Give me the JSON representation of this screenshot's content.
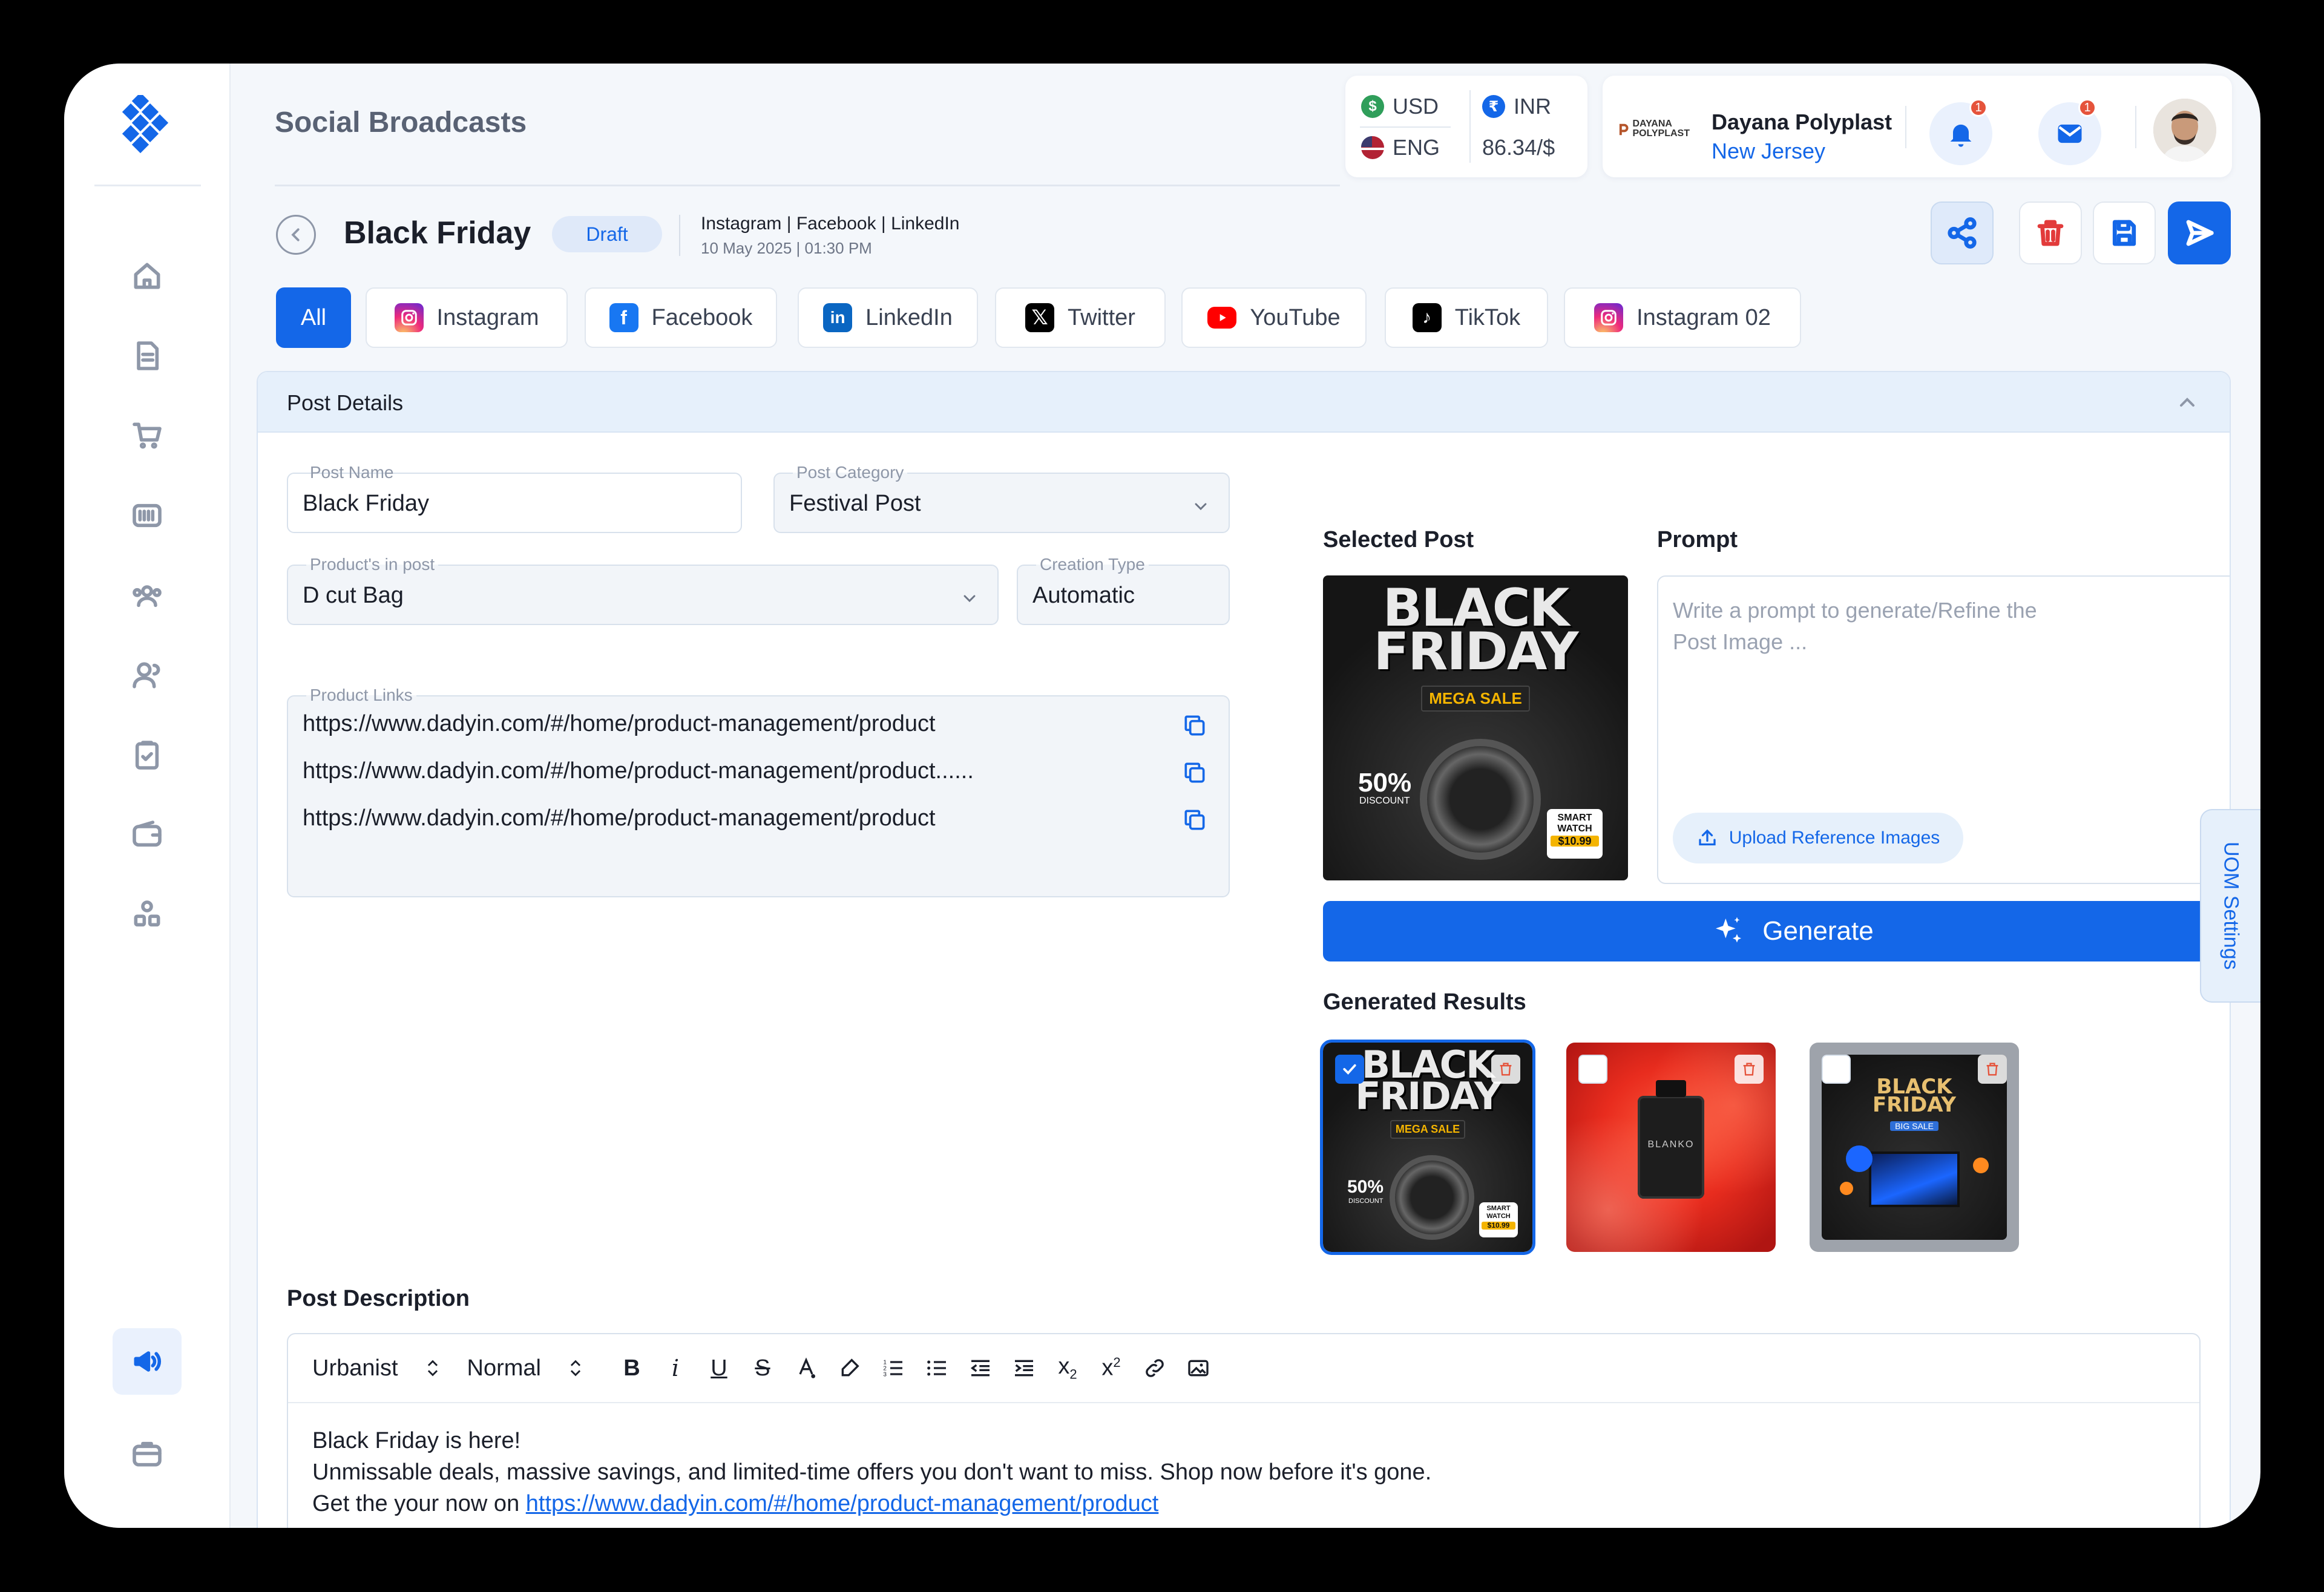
{
  "app": {
    "page_title": "Social Broadcasts"
  },
  "currency": {
    "base": {
      "code": "USD",
      "icon": "dollar-icon"
    },
    "language": {
      "code": "ENG",
      "icon": "us-flag-icon"
    },
    "target": {
      "code": "INR",
      "icon": "rupee-icon"
    },
    "rate": "86.34/$"
  },
  "company": {
    "name": "Dayana Polyplast",
    "location": "New Jersey",
    "logo_text": "DAYANA POLYPLAST"
  },
  "notifications": {
    "bell_count": "1",
    "mail_count": "1"
  },
  "post": {
    "title": "Black Friday",
    "status": "Draft",
    "platforms": "Instagram | Facebook | LinkedIn",
    "datetime": "10 May 2025 | 01:30 PM"
  },
  "tabs": [
    {
      "label": "All",
      "icon": ""
    },
    {
      "label": "Instagram",
      "icon": "instagram-icon"
    },
    {
      "label": "Facebook",
      "icon": "facebook-icon"
    },
    {
      "label": "LinkedIn",
      "icon": "linkedin-icon"
    },
    {
      "label": "Twitter",
      "icon": "x-icon"
    },
    {
      "label": "YouTube",
      "icon": "youtube-icon"
    },
    {
      "label": "TikTok",
      "icon": "tiktok-icon"
    },
    {
      "label": "Instagram 02",
      "icon": "instagram-icon"
    }
  ],
  "details": {
    "section_title": "Post Details",
    "post_name": {
      "label": "Post Name",
      "value": "Black Friday"
    },
    "post_category": {
      "label": "Post Category",
      "value": "Festival Post"
    },
    "products": {
      "label": "Product's in post",
      "value": "D cut Bag"
    },
    "creation_type": {
      "label": "Creation Type",
      "value": "Automatic"
    },
    "product_links": {
      "label": "Product Links",
      "links": [
        "https://www.dadyin.com/#/home/product-management/product",
        "https://www.dadyin.com/#/home/product-management/product......",
        "https://www.dadyin.com/#/home/product-management/product"
      ]
    }
  },
  "selected_post": {
    "label": "Selected Post",
    "poster": {
      "line1": "BLACK",
      "line2": "FRIDAY",
      "badge": "MEGA SALE",
      "percent": "50%",
      "discount": "DISCOUNT",
      "watch1": "SMART",
      "watch2": "WATCH",
      "price": "$10.99"
    }
  },
  "prompt": {
    "label": "Prompt",
    "placeholder": "Write a prompt to generate/Refine the Post Image ...",
    "upload_label": "Upload Reference Images"
  },
  "generate_label": "Generate",
  "results": {
    "label": "Generated Results",
    "items": [
      {
        "selected": true
      },
      {
        "selected": false,
        "brand": "BLANKO"
      },
      {
        "selected": false,
        "line1": "BLACK",
        "line2": "FRIDAY",
        "badge": "BIG SALE"
      }
    ]
  },
  "description": {
    "label": "Post Description",
    "font": "Urbanist",
    "style": "Normal",
    "line1": "Black Friday is here!",
    "line2": "Unmissable deals, massive savings, and limited-time offers you don't want to miss. Shop now before it's gone.",
    "line3_prefix": "Get the your now on ",
    "line3_link": "https://www.dadyin.com/#/home/product-management/product"
  },
  "uom_settings_label": "UOM Settings",
  "colors": {
    "accent": "#1467e8",
    "panel_head": "#e6f0fb",
    "badge": "#e5533b"
  }
}
